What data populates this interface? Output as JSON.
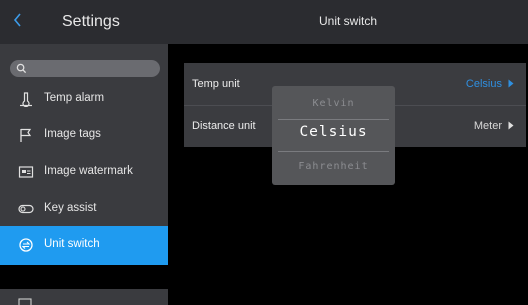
{
  "sidebar": {
    "title": "Settings",
    "search_placeholder": "",
    "items": [
      {
        "label": "Temp alarm",
        "icon": "thermometer-icon"
      },
      {
        "label": "Image tags",
        "icon": "flag-icon"
      },
      {
        "label": "Image watermark",
        "icon": "watermark-icon"
      },
      {
        "label": "Key assist",
        "icon": "toggle-icon"
      },
      {
        "label": "Unit switch",
        "icon": "unit-switch-icon",
        "active": true
      }
    ]
  },
  "main": {
    "title": "Unit switch",
    "rows": [
      {
        "label": "Temp unit",
        "value": "Celsius"
      },
      {
        "label": "Distance unit",
        "value": "Meter"
      }
    ]
  },
  "picker": {
    "options": [
      "Kelvin",
      "Celsius",
      "Fahrenheit"
    ],
    "selected": "Celsius"
  },
  "colors": {
    "accent": "#1f9bf0",
    "selected_value": "#2f8fe0",
    "sidebar_bg": "#3a3b3f",
    "header_bg": "#2b2c30"
  }
}
